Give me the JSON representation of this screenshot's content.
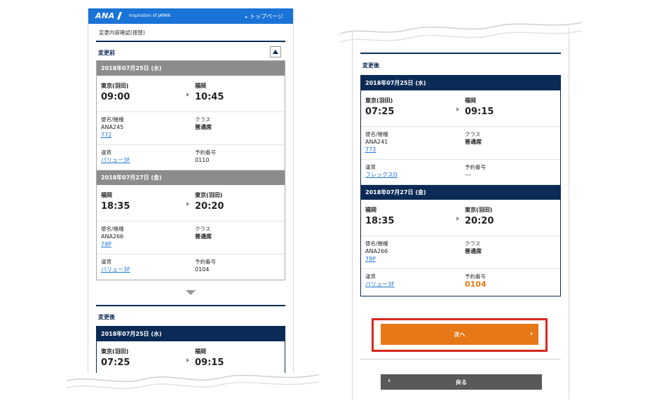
{
  "left": {
    "header": {
      "logo": "ANA",
      "tagline": "Inspiration of JAPAN",
      "top_link": "トップページ"
    },
    "breadcrumb": "変更内容確認(振替)",
    "before": {
      "title": "変更前",
      "segments": [
        {
          "date": "2018年07月25日 (水)",
          "from": "東京(羽田)",
          "dep": "09:00",
          "to": "福岡",
          "arr": "10:45",
          "flight_label": "便名/機種",
          "flight": "ANA245",
          "aircraft": "772",
          "class_label": "クラス",
          "class": "普通席",
          "fare_label": "運賃",
          "fare": "バリュー3F",
          "booking_label": "予約番号",
          "booking": "0110"
        },
        {
          "date": "2018年07月27日 (金)",
          "from": "福岡",
          "dep": "18:35",
          "to": "東京(羽田)",
          "arr": "20:20",
          "flight_label": "便名/機種",
          "flight": "ANA266",
          "aircraft": "78P",
          "class_label": "クラス",
          "class": "普通席",
          "fare_label": "運賃",
          "fare": "バリュー3F",
          "booking_label": "予約番号",
          "booking": "0104"
        }
      ]
    },
    "after": {
      "title": "変更後",
      "segment": {
        "date": "2018年07月25日 (水)",
        "from": "東京(羽田)",
        "dep": "07:25",
        "to": "福岡",
        "arr": "09:15"
      }
    }
  },
  "right": {
    "after": {
      "title": "変更後",
      "segments": [
        {
          "date": "2018年07月25日 (水)",
          "from": "東京(羽田)",
          "dep": "07:25",
          "to": "福岡",
          "arr": "09:15",
          "flight_label": "便名/機種",
          "flight": "ANA241",
          "aircraft": "773",
          "class_label": "クラス",
          "class": "普通席",
          "fare_label": "運賃",
          "fare": "フレックスD",
          "booking_label": "予約番号",
          "booking": "---"
        },
        {
          "date": "2018年07月27日 (金)",
          "from": "福岡",
          "dep": "18:35",
          "to": "東京(羽田)",
          "arr": "20:20",
          "flight_label": "便名/機種",
          "flight": "ANA266",
          "aircraft": "78P",
          "class_label": "クラス",
          "class": "普通席",
          "fare_label": "運賃",
          "fare": "バリュー3F",
          "booking_label": "予約番号",
          "booking": "0104"
        }
      ]
    },
    "next_label": "次へ",
    "back_label": "戻る"
  },
  "colors": {
    "header_blue": "#1a73d6",
    "navy": "#0b2a55",
    "orange": "#e67817",
    "highlight_red": "#d9261c",
    "gray_bar": "#8c8c8c"
  }
}
